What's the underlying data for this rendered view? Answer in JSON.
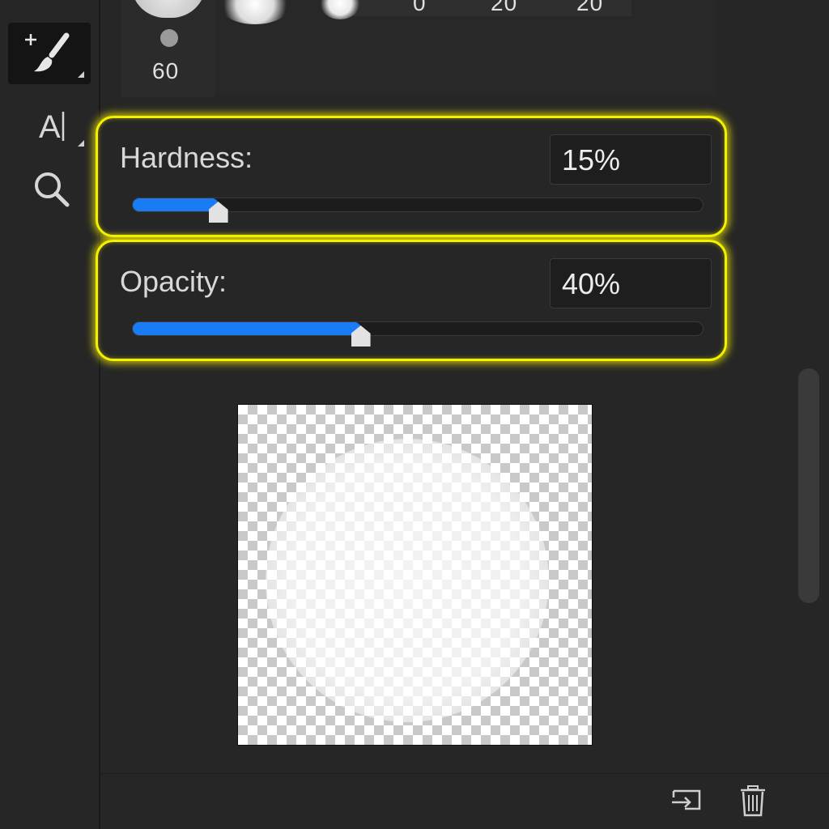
{
  "toolbar": {
    "tools": [
      {
        "name": "brush-tool",
        "icon": "brush-plus-icon",
        "selected": true
      },
      {
        "name": "type-tool",
        "icon": "type-cursor-icon",
        "label": "A|"
      },
      {
        "name": "zoom-tool",
        "icon": "magnifier-icon"
      }
    ]
  },
  "presets": {
    "size_label": "60",
    "header_values": [
      "0",
      "20",
      "20"
    ]
  },
  "hardness": {
    "label": "Hardness:",
    "value_text": "15%",
    "value": 0.15
  },
  "opacity": {
    "label": "Opacity:",
    "value_text": "40%",
    "value": 0.4
  },
  "colors": {
    "accent": "#1a7cf5",
    "highlight": "#f4f000",
    "background": "#262626"
  },
  "actions": [
    {
      "name": "export-brush-button",
      "icon": "export-icon"
    },
    {
      "name": "delete-brush-button",
      "icon": "trash-icon"
    }
  ]
}
